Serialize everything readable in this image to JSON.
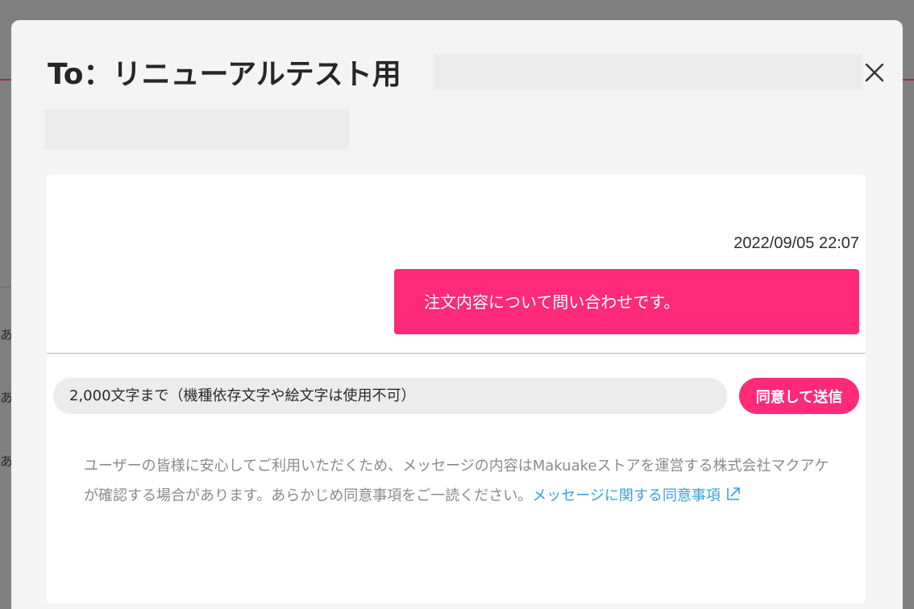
{
  "background": {
    "side_chars": [
      "あ",
      "あ",
      "あ"
    ]
  },
  "modal": {
    "title": "To：リニューアルテスト用",
    "close_icon": "close-icon"
  },
  "conversation": {
    "messages": [
      {
        "timestamp": "2022/09/05 22:07",
        "text": "注文内容について問い合わせです。"
      }
    ]
  },
  "composer": {
    "placeholder": "2,000文字まで（機種依存文字や絵文字は使用不可）",
    "value": "",
    "send_label": "同意して送信"
  },
  "notice": {
    "text": "ユーザーの皆様に安心してご利用いただくため、メッセージの内容はMakuakeストアを運営する株式会社マクアケが確認する場合があります。あらかじめ同意事項をご一読ください。",
    "link_label": "メッセージに関する同意事項",
    "link_icon": "external-link-icon"
  },
  "colors": {
    "accent": "#ff2a78",
    "link": "#36a3d6",
    "overlay": "#7f7f7f",
    "modal_bg": "#f4f4f4"
  }
}
